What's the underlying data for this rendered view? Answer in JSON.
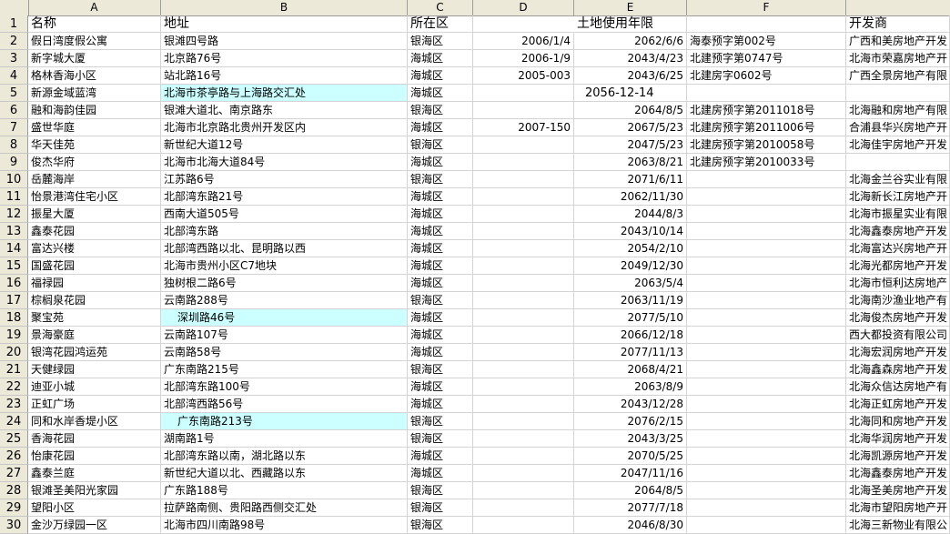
{
  "columns": [
    "A",
    "B",
    "C",
    "D",
    "E",
    "F"
  ],
  "header_row": {
    "num": "1",
    "a": "名称",
    "b": "地址",
    "c": "所在区",
    "d": "",
    "e": "土地使用年限",
    "f": "",
    "g": "开发商"
  },
  "rows": [
    {
      "num": "2",
      "a": "假日湾度假公寓",
      "b": "银滩四号路",
      "c": "银海区",
      "d": "2006/1/4",
      "e": "2062/6/6",
      "f": "海泰预字第002号",
      "g": "广西和美房地产开发"
    },
    {
      "num": "3",
      "a": "新字城大厦",
      "b": "北京路76号",
      "c": "海城区",
      "d": "2006-1/9",
      "e": "2043/4/23",
      "f": "北建预字第0747号",
      "g": "北海市荣嘉房地产开"
    },
    {
      "num": "4",
      "a": "格林香海小区",
      "b": "站北路16号",
      "c": "海城区",
      "d": "2005-003",
      "e": "2043/6/25",
      "f": "北建房字0602号",
      "g": "广西全景房地产有限"
    },
    {
      "num": "5",
      "a": "新源金域蓝湾",
      "b": "北海市茶亭路与上海路交汇处",
      "c": "海城区",
      "d": "",
      "e": "2056-12-14",
      "f": "",
      "g": ""
    },
    {
      "num": "6",
      "a": "融和海韵佳园",
      "b": "银滩大道北、南京路东",
      "c": "银海区",
      "d": "",
      "e": "2064/8/5",
      "f": "北建房预字第2011018号",
      "g": "北海融和房地产有限"
    },
    {
      "num": "7",
      "a": "盛世华庭",
      "b": "北海市北京路北贵州开发区内",
      "c": "海城区",
      "d": "2007-150",
      "e": "2067/5/23",
      "f": "北建房预字第2011006号",
      "g": "合浦县华兴房地产开"
    },
    {
      "num": "8",
      "a": "华天佳苑",
      "b": "新世纪大道12号",
      "c": "银海区",
      "d": "",
      "e": "2047/5/23",
      "f": "北建房预字第2010058号",
      "g": "北海佳宇房地产开发"
    },
    {
      "num": "9",
      "a": "俊杰华府",
      "b": "北海市北海大道84号",
      "c": "海城区",
      "d": "",
      "e": "2063/8/21",
      "f": "北建房预字第2010033号",
      "g": ""
    },
    {
      "num": "10",
      "a": "岳麓海岸",
      "b": "江苏路6号",
      "c": "银海区",
      "d": "",
      "e": "2071/6/11",
      "f": "",
      "g": "北海金兰谷实业有限"
    },
    {
      "num": "11",
      "a": "怡景港湾住宅小区",
      "b": "北部湾东路21号",
      "c": "海城区",
      "d": "",
      "e": "2062/11/30",
      "f": "",
      "g": "北海新长江房地产开"
    },
    {
      "num": "12",
      "a": "振星大厦",
      "b": "西南大道505号",
      "c": "海城区",
      "d": "",
      "e": "2044/8/3",
      "f": "",
      "g": "北海市振星实业有限"
    },
    {
      "num": "13",
      "a": "鑫泰花园",
      "b": "北部湾东路",
      "c": "海城区",
      "d": "",
      "e": "2043/10/14",
      "f": "",
      "g": "北海鑫泰房地产开发"
    },
    {
      "num": "14",
      "a": "富达兴楼",
      "b": "北部湾西路以北、昆明路以西",
      "c": "海城区",
      "d": "",
      "e": "2054/2/10",
      "f": "",
      "g": "北海富达兴房地产开"
    },
    {
      "num": "15",
      "a": "国盛花园",
      "b": "北海市贵州小区C7地块",
      "c": "海城区",
      "d": "",
      "e": "2049/12/30",
      "f": "",
      "g": "北海光都房地产开发"
    },
    {
      "num": "16",
      "a": "福禄园",
      "b": "独树根二路6号",
      "c": "海城区",
      "d": "",
      "e": "2063/5/4",
      "f": "",
      "g": "北海市恒利达房地产"
    },
    {
      "num": "17",
      "a": "棕榈泉花园",
      "b": "云南路288号",
      "c": "银海区",
      "d": "",
      "e": "2063/11/19",
      "f": "",
      "g": "北海南沙渔业地产有"
    },
    {
      "num": "18",
      "a": "聚宝苑",
      "b": "深圳路46号",
      "c": "海城区",
      "d": "",
      "e": "2077/5/10",
      "f": "",
      "g": "北海俊杰房地产开发"
    },
    {
      "num": "19",
      "a": "景海豪庭",
      "b": "云南路107号",
      "c": "海城区",
      "d": "",
      "e": "2066/12/18",
      "f": "",
      "g": "西大都投资有限公司"
    },
    {
      "num": "20",
      "a": "银湾花园鸿运苑",
      "b": "云南路58号",
      "c": "海城区",
      "d": "",
      "e": "2077/11/13",
      "f": "",
      "g": "北海宏润房地产开发"
    },
    {
      "num": "21",
      "a": "天健绿园",
      "b": "广东南路215号",
      "c": "银海区",
      "d": "",
      "e": "2068/4/21",
      "f": "",
      "g": "北海鑫森房地产开发"
    },
    {
      "num": "22",
      "a": "迪亚小城",
      "b": "北部湾东路100号",
      "c": "海城区",
      "d": "",
      "e": "2063/8/9",
      "f": "",
      "g": "北海众信达房地产有"
    },
    {
      "num": "23",
      "a": "正虹广场",
      "b": "北部湾西路56号",
      "c": "海城区",
      "d": "",
      "e": "2043/12/28",
      "f": "",
      "g": "北海正虹房地产开发"
    },
    {
      "num": "24",
      "a": "同和水岸香堤小区",
      "b": "广东南路213号",
      "c": "银海区",
      "d": "",
      "e": "2076/2/15",
      "f": "",
      "g": "北海同和房地产开发"
    },
    {
      "num": "25",
      "a": "香海花园",
      "b": "湖南路1号",
      "c": "银海区",
      "d": "",
      "e": "2043/3/25",
      "f": "",
      "g": "北海华润房地产开发"
    },
    {
      "num": "26",
      "a": "怡康花园",
      "b": "北部湾东路以南，湖北路以东",
      "c": "海城区",
      "d": "",
      "e": "2070/5/25",
      "f": "",
      "g": "北海凯源房地产开发"
    },
    {
      "num": "27",
      "a": "鑫泰兰庭",
      "b": "新世纪大道以北、西藏路以东",
      "c": "海城区",
      "d": "",
      "e": "2047/11/16",
      "f": "",
      "g": "北海鑫泰房地产开发"
    },
    {
      "num": "28",
      "a": "银滩圣美阳光家园",
      "b": "广东路188号",
      "c": "银海区",
      "d": "",
      "e": "2064/8/5",
      "f": "",
      "g": "北海圣美房地产开发"
    },
    {
      "num": "29",
      "a": "望阳小区",
      "b": "拉萨路南侧、贵阳路西侧交汇处",
      "c": "银海区",
      "d": "",
      "e": "2077/7/18",
      "f": "",
      "g": "北海市望阳房地产开"
    },
    {
      "num": "30",
      "a": "金沙万绿园一区",
      "b": "北海市四川南路98号",
      "c": "银海区",
      "d": "",
      "e": "2046/8/30",
      "f": "",
      "g": "北海三新物业有限公"
    }
  ],
  "colors": {
    "highlight": "#ccffff",
    "header_bg": "#ece9d8"
  }
}
